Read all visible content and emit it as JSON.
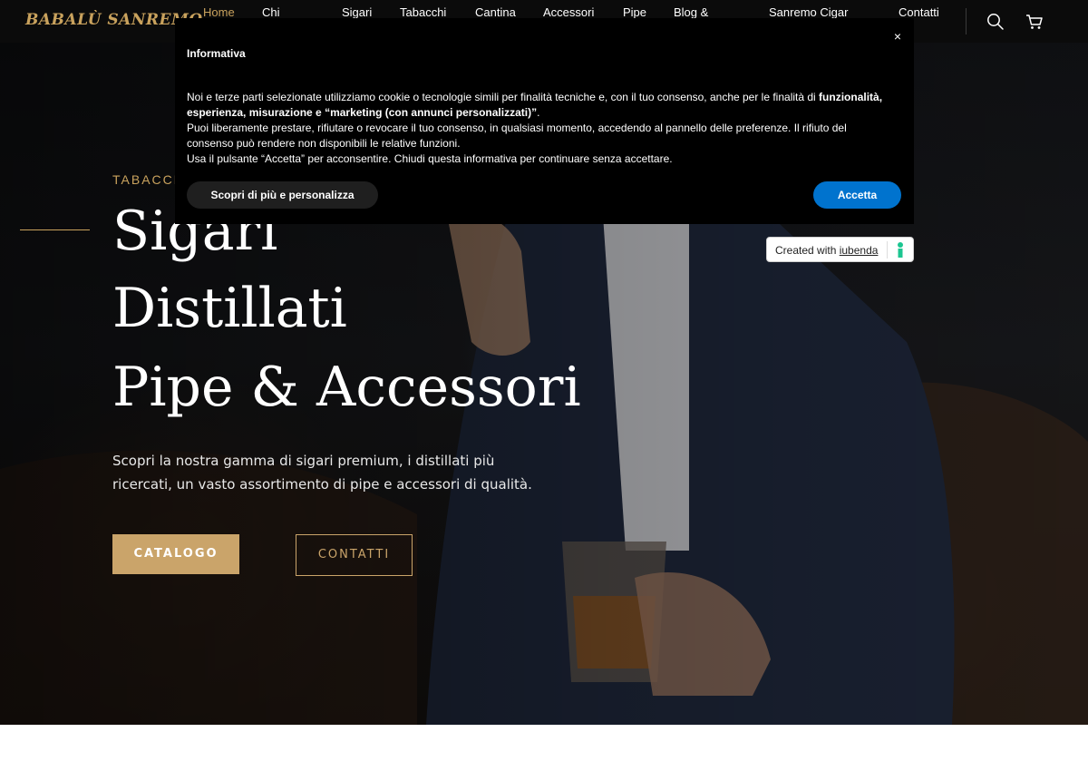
{
  "header": {
    "logo_text": "Babalù Sanremo",
    "nav": [
      {
        "label": "Home",
        "active": true
      },
      {
        "label": "Chi",
        "active": false
      },
      {
        "label": "Sigari",
        "active": false
      },
      {
        "label": "Tabacchi",
        "active": false
      },
      {
        "label": "Cantina",
        "active": false
      },
      {
        "label": "Accessori",
        "active": false
      },
      {
        "label": "Pipe",
        "active": false
      },
      {
        "label": "Blog &",
        "active": false
      },
      {
        "label": "Sanremo Cigar",
        "active": false
      },
      {
        "label": "Contatti",
        "active": false
      }
    ],
    "icons": [
      "search-icon",
      "cart-icon"
    ]
  },
  "hero": {
    "eyebrow": "Tabacchi",
    "headline_lines": [
      "Sigari",
      "Distillati",
      "Pipe & Accessori"
    ],
    "description": "Scopri la nostra gamma di sigari premium, i distillati più ricercati, un vasto assortimento di pipe e accessori di qualità.",
    "catalog_button": "Catalogo",
    "contact_button": "Contatti"
  },
  "cookie_banner": {
    "title": "Informativa",
    "close_symbol": "×",
    "p1_pre": "Noi e terze parti selezionate utilizziamo cookie o tecnologie simili per finalità tecniche e, con il tuo consenso, anche per le finalità di ",
    "p1_bold": "funzionalità, esperienza, misurazione e “marketing (con annunci personalizzati)”",
    "p1_post": ".",
    "p2": "Puoi liberamente prestare, rifiutare o revocare il tuo consenso, in qualsiasi momento, accedendo al pannello delle preferenze. Il rifiuto del consenso può rendere non disponibili le relative funzioni.",
    "p3": "Usa il pulsante “Accetta” per acconsentire. Chiudi questa informativa per continuare senza accettare.",
    "more_button": "Scopri di più e personalizza",
    "accept_button": "Accetta"
  },
  "iubenda_badge": {
    "prefix": "Created with ",
    "link": "iubenda"
  },
  "colors": {
    "accent_gold": "#caa46a",
    "accept_blue": "#0073ce",
    "header_bg": "#0b0b0b"
  }
}
